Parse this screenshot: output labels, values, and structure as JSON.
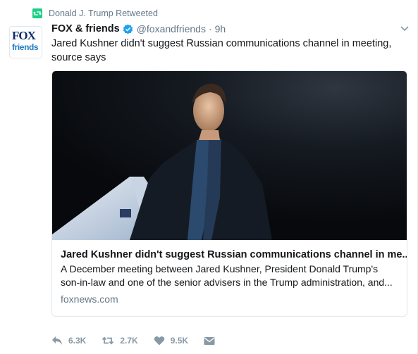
{
  "retweet_context": {
    "text": "Donald J. Trump Retweeted"
  },
  "author": {
    "name": "FOX & friends",
    "handle": "@foxandfriends",
    "separator": "·",
    "time": "9h"
  },
  "avatar": {
    "line1": "FOX",
    "line2": "friends"
  },
  "tweet": {
    "text": "Jared Kushner didn't suggest Russian communications channel in meeting, source says"
  },
  "card": {
    "title": "Jared Kushner didn't suggest Russian communications channel in me..",
    "description": "A December meeting between Jared Kushner, President Donald Trump's son-in-law and one of the senior advisers in the Trump administration, and...",
    "domain": "foxnews.com"
  },
  "actions": {
    "replies": "6.3K",
    "retweets": "2.7K",
    "likes": "9.5K"
  },
  "colors": {
    "accent": "#1da1f2",
    "retweet_green": "#19cf86",
    "muted": "#8899a6",
    "text": "#14171a"
  },
  "icons": [
    "retweet-icon",
    "verified-icon",
    "chevron-down-icon",
    "reply-icon",
    "like-icon",
    "direct-message-icon"
  ]
}
